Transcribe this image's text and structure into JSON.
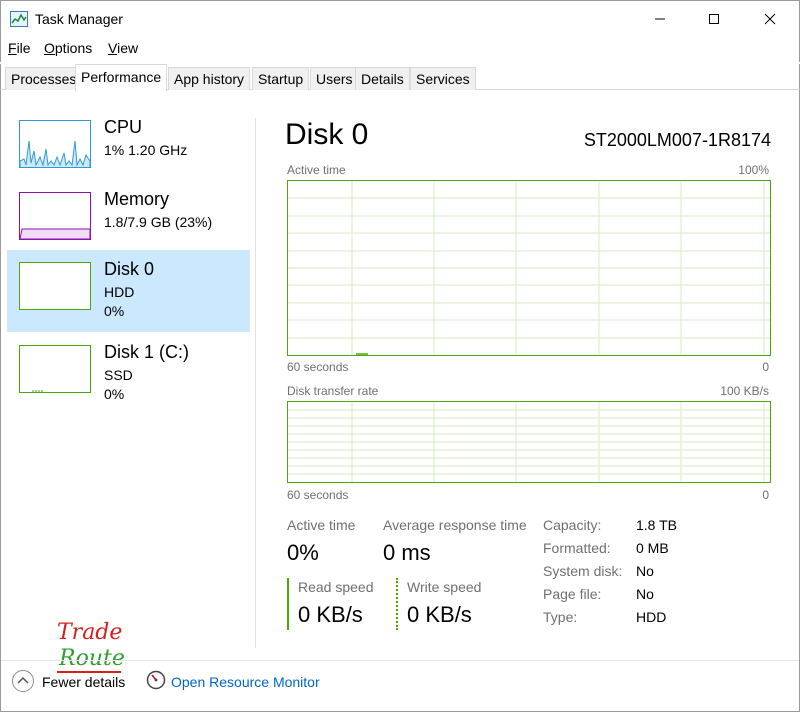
{
  "window": {
    "title": "Task Manager"
  },
  "menu": [
    "File",
    "Options",
    "View"
  ],
  "tabs": [
    "Processes",
    "Performance",
    "App history",
    "Startup",
    "Users",
    "Details",
    "Services"
  ],
  "sidebar": [
    {
      "title": "CPU",
      "sub1": "1%  1.20 GHz",
      "sub2": ""
    },
    {
      "title": "Memory",
      "sub1": "1.8/7.9 GB (23%)",
      "sub2": ""
    },
    {
      "title": "Disk 0",
      "sub1": "HDD",
      "sub2": "0%"
    },
    {
      "title": "Disk 1 (C:)",
      "sub1": "SSD",
      "sub2": "0%"
    }
  ],
  "disk": {
    "title": "Disk 0",
    "model": "ST2000LM007-1R8174",
    "graph1": {
      "label": "Active time",
      "max": "100%",
      "time": "60 seconds",
      "min": "0"
    },
    "graph2": {
      "label": "Disk transfer rate",
      "max": "100 KB/s",
      "time": "60 seconds",
      "min": "0"
    },
    "stats": {
      "active_time_label": "Active time",
      "active_time_value": "0%",
      "avg_resp_label": "Average response time",
      "avg_resp_value": "0 ms",
      "read_label": "Read speed",
      "read_value": "0 KB/s",
      "write_label": "Write speed",
      "write_value": "0 KB/s"
    },
    "props": [
      {
        "label": "Capacity:",
        "value": "1.8 TB"
      },
      {
        "label": "Formatted:",
        "value": "0 MB"
      },
      {
        "label": "System disk:",
        "value": "No"
      },
      {
        "label": "Page file:",
        "value": "No"
      },
      {
        "label": "Type:",
        "value": "HDD"
      }
    ]
  },
  "logo": {
    "line1": "Trade",
    "line2": "Route"
  },
  "footer": {
    "fewer": "Fewer details",
    "monitor": "Open Resource Monitor"
  },
  "colors": {
    "cpu": "#2d9ad8",
    "memory": "#8b12ae",
    "disk": "#4da60c",
    "selected": "#cce8ff",
    "link": "#0066cc"
  },
  "icons": [
    "task-manager-icon",
    "minimize-icon",
    "maximize-icon",
    "close-icon",
    "chevron-up-icon",
    "resource-monitor-icon"
  ]
}
